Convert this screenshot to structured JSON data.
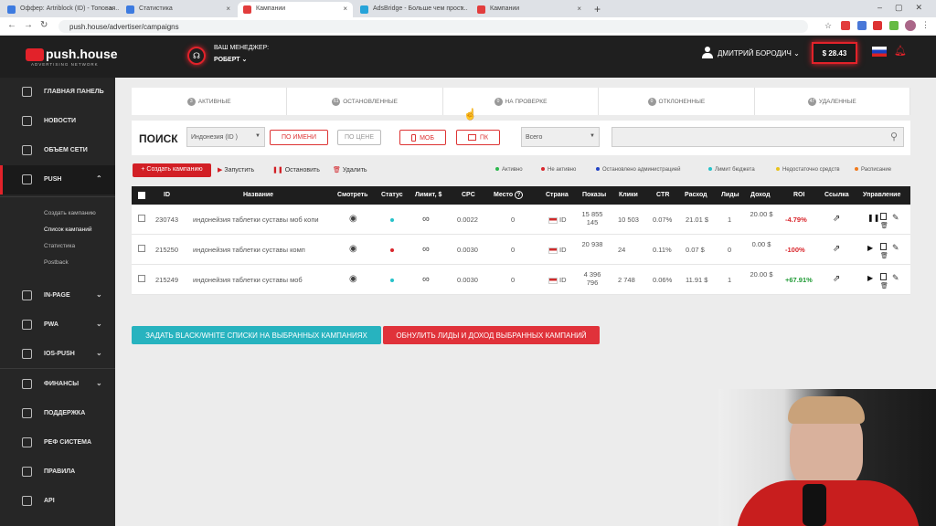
{
  "browser": {
    "tabs": [
      {
        "label": "Оффер: Artriblock (ID) - Топовая...",
        "fav": "#3d7be0",
        "active": false
      },
      {
        "label": "Статистика",
        "fav": "#3d7be0",
        "active": false
      },
      {
        "label": "Кампании",
        "fav": "#e23d3d",
        "active": true
      },
      {
        "label": "AdsBridge - Больше чем прост...",
        "fav": "#26a3d9",
        "active": false
      },
      {
        "label": "Кампании",
        "fav": "#e23d3d",
        "active": false
      }
    ],
    "new_tab": "+",
    "url": "push.house/advertiser/campaigns"
  },
  "header": {
    "logo_text": "push.house",
    "logo_sub": "ADVERTISING NETWORK",
    "manager_label": "ВАШ МЕНЕДЖЕР:",
    "manager_name": "РОБЕРТ",
    "user_name": "ДМИТРИЙ БОРОДИЧ",
    "balance": "$ 28.43"
  },
  "sidebar": {
    "items": [
      {
        "label": "ГЛАВНАЯ ПАНЕЛЬ",
        "chevron": false
      },
      {
        "label": "НОВОСТИ",
        "chevron": false
      },
      {
        "label": "ОБЪЕМ СЕТИ",
        "chevron": false
      },
      {
        "label": "PUSH",
        "chevron": true
      },
      {
        "label": "IN-PAGE",
        "chevron": true
      },
      {
        "label": "PWA",
        "chevron": true
      },
      {
        "label": "IOS-PUSH",
        "chevron": true
      },
      {
        "label": "ФИНАНСЫ",
        "chevron": true
      },
      {
        "label": "ПОДДЕРЖКА",
        "chevron": false
      },
      {
        "label": "РЕФ СИСТЕМА",
        "chevron": false
      },
      {
        "label": "ПРАВИЛА",
        "chevron": false
      },
      {
        "label": "API",
        "chevron": false
      }
    ],
    "push_sub": [
      "Создать кампанию",
      "Список кампаний",
      "Статистика",
      "Postback"
    ]
  },
  "status_tabs": [
    {
      "count": "3",
      "label": "АКТИВНЫЕ"
    },
    {
      "count": "61",
      "label": "ОСТАНОВЛЕННЫЕ"
    },
    {
      "count": "0",
      "label": "НА ПРОВЕРКЕ"
    },
    {
      "count": "0",
      "label": "ОТКЛОНЕННЫЕ"
    },
    {
      "count": "47",
      "label": "УДАЛЕННЫЕ"
    }
  ],
  "search": {
    "title": "ПОИСК",
    "country": "Индонезия (ID )",
    "by_name": "ПО ИМЕНИ",
    "by_price": "ПО ЦЕНЕ",
    "mob": "МОБ",
    "pc": "ПК",
    "scope": "Всего"
  },
  "actions": {
    "create": "+ Создать кампанию",
    "start": "Запустить",
    "stop": "Остановить",
    "delete": "Удалить"
  },
  "legend": [
    {
      "label": "Активно",
      "color": "#2db84d"
    },
    {
      "label": "Не активно",
      "color": "#d9262c"
    },
    {
      "label": "Остановлено администрацией",
      "color": "#2343c4"
    },
    {
      "label": "Лимит бюджета",
      "color": "#27c2c9"
    },
    {
      "label": "Недостаточно средств",
      "color": "#e8c21c"
    },
    {
      "label": "Расписание",
      "color": "#f07a1c"
    }
  ],
  "table": {
    "headers": [
      "ID",
      "Название",
      "Смотреть",
      "Статус",
      "Лимит, $",
      "CPC",
      "Место",
      "Страна",
      "Показы",
      "Клики",
      "CTR",
      "Расход",
      "Лиды",
      "Доход",
      "ROI",
      "Ссылка",
      "Управление"
    ],
    "rows": [
      {
        "id": "230743",
        "name": "индонейзия таблетки суставы моб копи",
        "status_color": "#27c2c9",
        "cpc": "0.0022",
        "place": "0",
        "country": "ID",
        "shows": "15 855 145",
        "clicks": "10 503",
        "ctr": "0.07%",
        "spend": "21.01 $",
        "leads": "1",
        "income": "20.00 $",
        "roi": "-4.79%",
        "roi_color": "#d9262c",
        "paused": true
      },
      {
        "id": "215250",
        "name": "индонейзия таблетки суставы комп",
        "status_color": "#d9262c",
        "cpc": "0.0030",
        "place": "0",
        "country": "ID",
        "shows": "20 938",
        "clicks": "24",
        "ctr": "0.11%",
        "spend": "0.07 $",
        "leads": "0",
        "income": "0.00 $",
        "roi": "-100%",
        "roi_color": "#d9262c",
        "paused": false
      },
      {
        "id": "215249",
        "name": "индонейзия таблетки суставы моб",
        "status_color": "#27c2c9",
        "cpc": "0.0030",
        "place": "0",
        "country": "ID",
        "shows": "4 396 796",
        "clicks": "2 748",
        "ctr": "0.06%",
        "spend": "11.91 $",
        "leads": "1",
        "income": "20.00 $",
        "roi": "+67.91%",
        "roi_color": "#1f9a34",
        "paused": false
      }
    ]
  },
  "bulk": {
    "blacklist": "ЗАДАТЬ BLACK/WHITE СПИСКИ НА ВЫБРАННЫХ КАМПАНИЯХ",
    "reset": "ОБНУЛИТЬ ЛИДЫ И ДОХОД ВЫБРАННЫХ КАМПАНИЙ"
  },
  "colors": {
    "accent": "#e2222a",
    "teal": "#27b3bf"
  }
}
